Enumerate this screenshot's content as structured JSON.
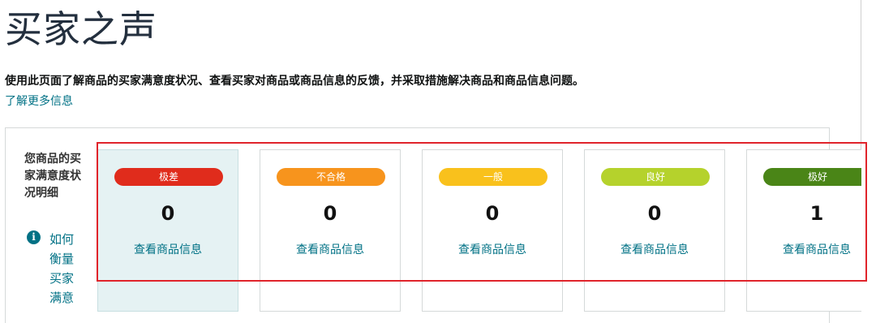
{
  "page": {
    "title": "买家之声",
    "description": "使用此页面了解商品的买家满意度状况、查看买家对商品或商品信息的反馈，并采取措施解决商品和商品信息问题。",
    "learn_more": "了解更多信息"
  },
  "summary": {
    "label": "您商品的买家满意度状况明细",
    "info_icon": "i",
    "how_link": "如何衡量买家满意"
  },
  "cards": [
    {
      "label": "极差",
      "count": "0",
      "link": "查看商品信息",
      "color": "#e02c1c",
      "selected": true
    },
    {
      "label": "不合格",
      "count": "0",
      "link": "查看商品信息",
      "color": "#f7941d",
      "selected": false
    },
    {
      "label": "一般",
      "count": "0",
      "link": "查看商品信息",
      "color": "#f9c11c",
      "selected": false
    },
    {
      "label": "良好",
      "count": "0",
      "link": "查看商品信息",
      "color": "#b5d22c",
      "selected": false
    },
    {
      "label": "极好",
      "count": "1",
      "link": "查看商品信息",
      "color": "#4a8517",
      "selected": false
    }
  ],
  "colors": {
    "link": "#007185",
    "highlight": "#e0242b",
    "selected_bg": "#e5f2f3"
  }
}
